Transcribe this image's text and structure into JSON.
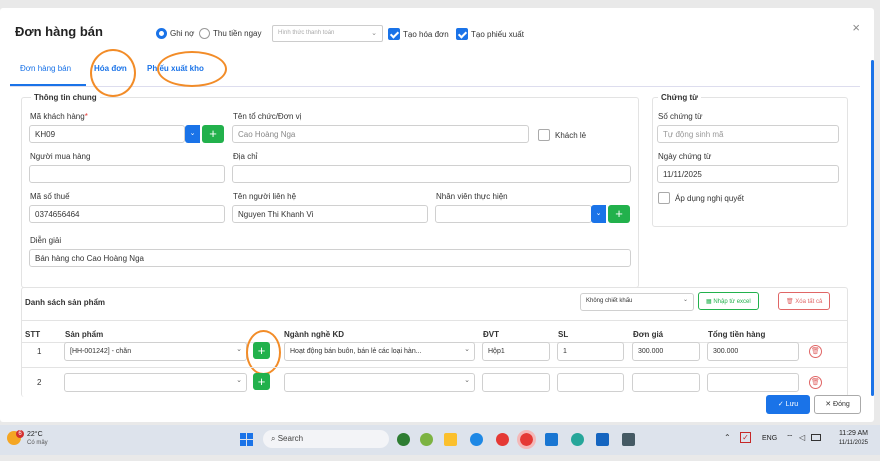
{
  "dialog": {
    "title": "Đơn hàng bán",
    "close_icon": "×"
  },
  "options": {
    "ghi_no": "Ghi nợ",
    "thu_tien_ngay": "Thu tiền ngay",
    "hinh_thuc_placeholder": "Hình thức thanh toán",
    "tao_hoa_don": "Tạo hóa đơn",
    "tao_phieu_xuat": "Tạo phiếu xuất"
  },
  "tabs": [
    "Đơn hàng bán",
    "Hóa đơn",
    "Phiếu xuất kho"
  ],
  "general": {
    "legend": "Thông tin chung",
    "ma_kh_label": "Mã khách hàng",
    "ma_kh_value": "KH09",
    "ten_to_chuc_label": "Tên tổ chức/Đơn vị",
    "ten_to_chuc_value": "Cao Hoàng Nga",
    "khach_le_label": "Khách lẻ",
    "nguoi_mua_label": "Người mua hàng",
    "dia_chi_label": "Địa chỉ",
    "ma_so_thue_label": "Mã số thuế",
    "ma_so_thue_value": "0374656464",
    "nguoi_lien_he_label": "Tên người liên hệ",
    "nguoi_lien_he_value": "Nguyen Thi Khanh Vi",
    "nhan_vien_label": "Nhân viên thực hiện",
    "dien_giai_label": "Diễn giải",
    "dien_giai_value": "Bán hàng cho Cao Hoàng Nga"
  },
  "voucher": {
    "legend": "Chứng từ",
    "so_label": "Số chứng từ",
    "so_placeholder": "Tự động sinh mã",
    "ngay_label": "Ngày chứng từ",
    "ngay_value": "11/11/2025",
    "ap_dung_label": "Áp dụng nghị quyết"
  },
  "products": {
    "title": "Danh sách sản phẩm",
    "discount_select": "Không chiết khấu",
    "import_label": "Nhập từ excel",
    "delete_all_label": "Xóa tất cả",
    "columns": [
      "STT",
      "Sản phẩm",
      "Ngành nghề KD",
      "ĐVT",
      "SL",
      "Đơn giá",
      "Tổng tiền hàng"
    ],
    "rows": [
      {
        "stt": "1",
        "product": "[HH-001242] - chăn",
        "nganh": "Hoạt động bán buôn, bán lẻ các loại hàn...",
        "dvt": "Hộp1",
        "sl": "1",
        "don_gia": "300.000",
        "tong": "300.000"
      },
      {
        "stt": "2",
        "product": "",
        "nganh": "",
        "dvt": "",
        "sl": "",
        "don_gia": "",
        "tong": ""
      }
    ]
  },
  "footer": {
    "save": "Lưu",
    "close": "Đóng"
  },
  "taskbar": {
    "temp": "22°C",
    "weather": "Có mây",
    "search": "Search",
    "lang": "ENG",
    "time": "11:29 AM",
    "date": "11/11/2025",
    "badge": "6"
  }
}
